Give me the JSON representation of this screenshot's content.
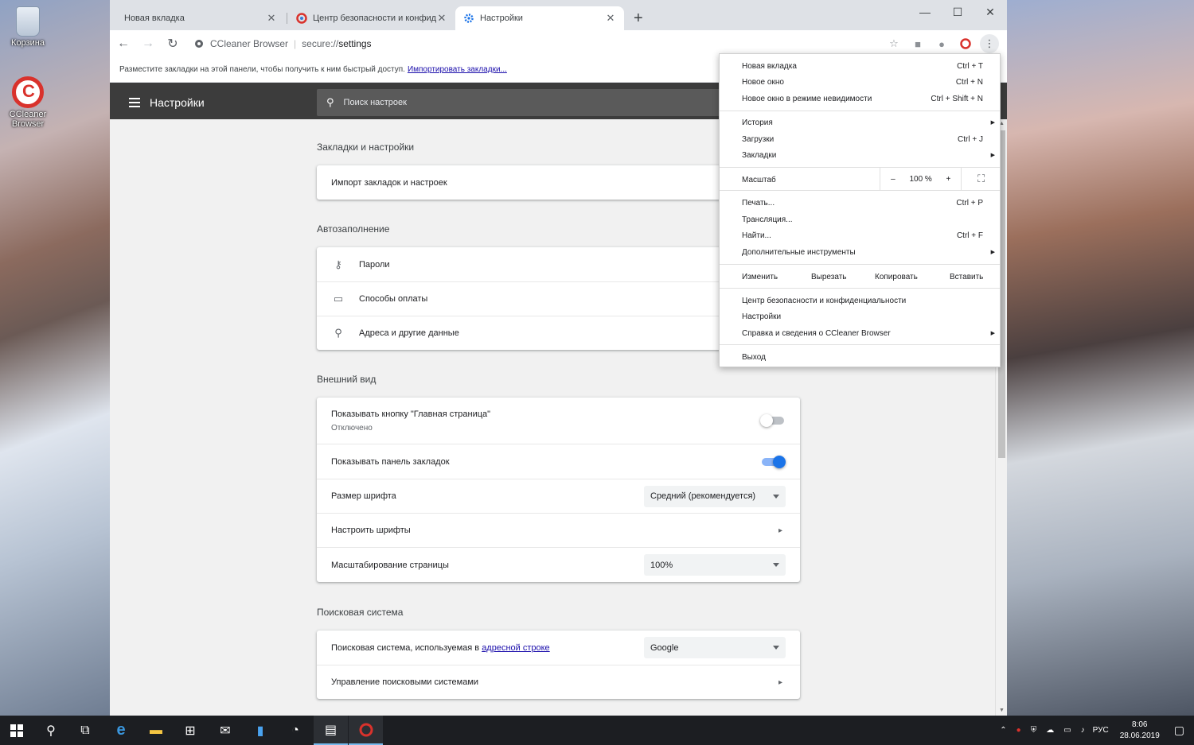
{
  "desktop": {
    "icons": [
      {
        "label": "Корзина",
        "icon": "recycle-bin-icon"
      },
      {
        "label": "CCleaner Browser",
        "icon": "ccleaner-browser-icon"
      }
    ]
  },
  "tabs": [
    {
      "label": "Новая вкладка",
      "active": false
    },
    {
      "label": "Центр безопасности и конфиде",
      "active": false,
      "icon": "ccleaner-icon"
    },
    {
      "label": "Настройки",
      "active": true,
      "icon": "gear-icon"
    }
  ],
  "window_controls": {
    "minimize": "—",
    "maximize": "☐",
    "close": "✕"
  },
  "omnibox": {
    "brand": "CCleaner Browser",
    "scheme": "secure://",
    "path": "settings"
  },
  "bookmarks_bar": {
    "text": "Разместите закладки на этой панели, чтобы получить к ним быстрый доступ.",
    "link": "Импортировать закладки..."
  },
  "settings_header": {
    "title": "Настройки",
    "search_placeholder": "Поиск настроек"
  },
  "sections": {
    "bookmarks": {
      "title": "Закладки и настройки",
      "rows": [
        "Импорт закладок и настроек"
      ]
    },
    "autofill": {
      "title": "Автозаполнение",
      "rows": [
        "Пароли",
        "Способы оплаты",
        "Адреса и другие данные"
      ]
    },
    "appearance": {
      "title": "Внешний вид",
      "home_button": {
        "label": "Показывать кнопку \"Главная страница\"",
        "sub": "Отключено",
        "on": false
      },
      "bookmarks_bar": {
        "label": "Показывать панель закладок",
        "on": true
      },
      "font_size": {
        "label": "Размер шрифта",
        "value": "Средний (рекомендуется)"
      },
      "fonts": {
        "label": "Настроить шрифты"
      },
      "zoom": {
        "label": "Масштабирование страницы",
        "value": "100%"
      }
    },
    "search": {
      "title": "Поисковая система",
      "engine": {
        "label_prefix": "Поисковая система, используемая в",
        "label_link": "адресной строке",
        "value": "Google"
      },
      "manage": {
        "label": "Управление поисковыми системами"
      }
    }
  },
  "menu": {
    "new_tab": {
      "label": "Новая вкладка",
      "shortcut": "Ctrl + T"
    },
    "new_window": {
      "label": "Новое окно",
      "shortcut": "Ctrl + N"
    },
    "incognito": {
      "label": "Новое окно в режиме невидимости",
      "shortcut": "Ctrl + Shift + N"
    },
    "history": {
      "label": "История"
    },
    "downloads": {
      "label": "Загрузки",
      "shortcut": "Ctrl + J"
    },
    "bookmarks": {
      "label": "Закладки"
    },
    "zoom": {
      "label": "Масштаб",
      "minus": "–",
      "value": "100 %",
      "plus": "+"
    },
    "print": {
      "label": "Печать...",
      "shortcut": "Ctrl + P"
    },
    "cast": {
      "label": "Трансляция..."
    },
    "find": {
      "label": "Найти...",
      "shortcut": "Ctrl + F"
    },
    "more_tools": {
      "label": "Дополнительные инструменты"
    },
    "edit": {
      "label": "Изменить",
      "cut": "Вырезать",
      "copy": "Копировать",
      "paste": "Вставить"
    },
    "security_center": {
      "label": "Центр безопасности и конфиденциальности"
    },
    "settings": {
      "label": "Настройки"
    },
    "help": {
      "label": "Справка и сведения о CCleaner Browser"
    },
    "exit": {
      "label": "Выход"
    }
  },
  "taskbar": {
    "language": "РУС",
    "time": "8:06",
    "date": "28.06.2019"
  },
  "colors": {
    "accent": "#1a73e8",
    "header": "#3c3c3c",
    "ccleaner_red": "#d9322c"
  }
}
